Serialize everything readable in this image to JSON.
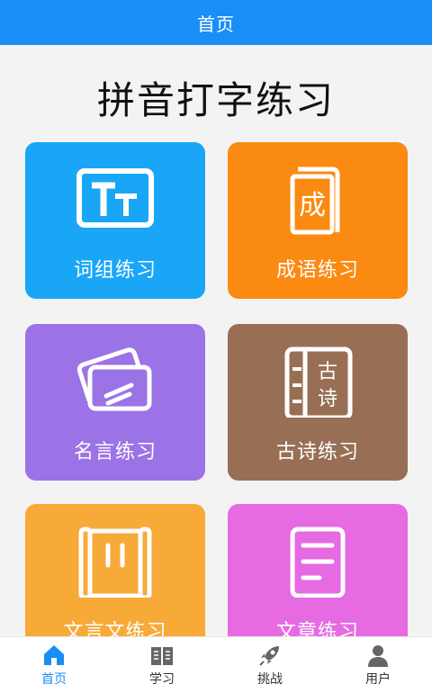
{
  "header": {
    "title": "首页"
  },
  "page": {
    "heading": "拼音打字练习"
  },
  "cards": [
    {
      "label": "词组练习",
      "color": "#1aa6f6",
      "icon": "text-tt-icon"
    },
    {
      "label": "成语练习",
      "color": "#fa8a12",
      "icon": "idiom-book-icon"
    },
    {
      "label": "名言练习",
      "color": "#9b73e6",
      "icon": "quote-cards-icon"
    },
    {
      "label": "古诗练习",
      "color": "#986f54",
      "icon": "ancient-poem-book-icon"
    },
    {
      "label": "文言文练习",
      "color": "#f7aa38",
      "icon": "scroll-icon"
    },
    {
      "label": "文章练习",
      "color": "#e66ae2",
      "icon": "article-icon"
    }
  ],
  "nav": [
    {
      "label": "首页",
      "icon": "home-icon",
      "active": true
    },
    {
      "label": "学习",
      "icon": "book-icon",
      "active": false
    },
    {
      "label": "挑战",
      "icon": "rocket-icon",
      "active": false
    },
    {
      "label": "用户",
      "icon": "user-icon",
      "active": false
    }
  ],
  "colors": {
    "primary": "#1a8ef7",
    "nav_inactive": "#666666"
  }
}
